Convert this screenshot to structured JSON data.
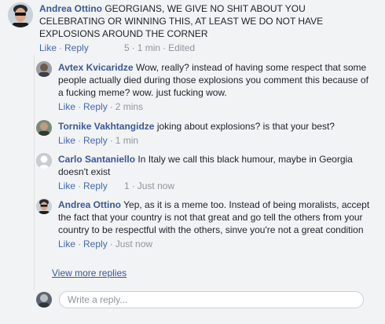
{
  "comments": [
    {
      "author": "Andrea Ottino",
      "text": "GEORGIANS, WE GIVE NO SHIT ABOUT YOU CELEBRATING OR WINNING THIS, AT LEAST WE DO NOT HAVE EXPLOSIONS AROUND THE CORNER",
      "like": "Like",
      "reply": "Reply",
      "likes": "5",
      "time": "1 min",
      "edited": "Edited"
    }
  ],
  "replies": [
    {
      "author": "Avtex Kvicaridze",
      "text": "Wow, really? instead of having some respect that some people actually died during those explosions you comment this because of a fucking meme? wow. just fucking wow.",
      "like": "Like",
      "reply": "Reply",
      "time": "2 mins"
    },
    {
      "author": "Tornike Vakhtangidze",
      "text": "joking about explosions? is that your best?",
      "like": "Like",
      "reply": "Reply",
      "time": "1 min"
    },
    {
      "author": "Carlo Santaniello",
      "text": "In Italy we call this black humour, maybe in Georgia doesn't exist",
      "like": "Like",
      "reply": "Reply",
      "likes": "1",
      "time": "Just now"
    },
    {
      "author": "Andrea Ottino",
      "text": "Yep, as it is a meme too. Instead of being moralists, accept the fact that your country is not that great and go tell the others from your country to be respectful with the others, sinve you're not a great condition",
      "like": "Like",
      "reply": "Reply",
      "time": "Just now"
    }
  ],
  "view_more": "View more replies",
  "reply_box": {
    "placeholder": "Write a reply..."
  }
}
